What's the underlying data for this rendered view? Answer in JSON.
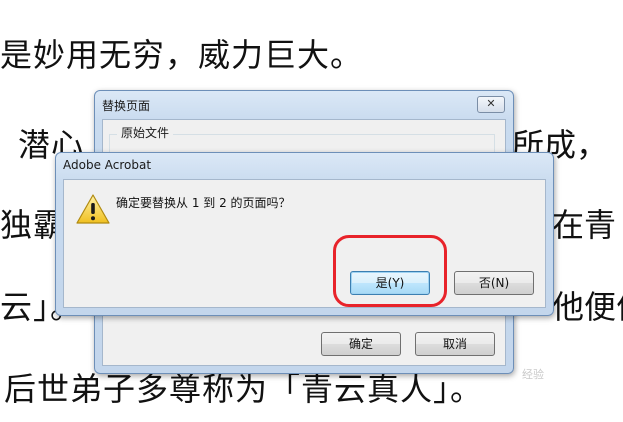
{
  "document": {
    "line1": "是妙用无穷，威力巨大。",
    "line2_left": "潜心",
    "line2_right": "所成，",
    "line3_left": "独霸",
    "line3_right": "在青",
    "line4_left": "云」。",
    "line4_right": "他便价",
    "line5": "后世弟子多尊称为「青云真人」。"
  },
  "replace_dialog": {
    "title": "替换页面",
    "close_label": "✕",
    "group_label": "原始文件",
    "ok_label": "确定",
    "cancel_label": "取消"
  },
  "confirm_dialog": {
    "title": "Adobe Acrobat",
    "message": "确定要替换从 1 到 2 的页面吗？",
    "icon": "warning-icon",
    "yes_label": "是(Y)",
    "no_label": "否(N)"
  },
  "watermark": "经验",
  "colors": {
    "highlight": "#e8232a",
    "dialog_frame": "#c9dbef",
    "default_button": "#bee6fd"
  }
}
